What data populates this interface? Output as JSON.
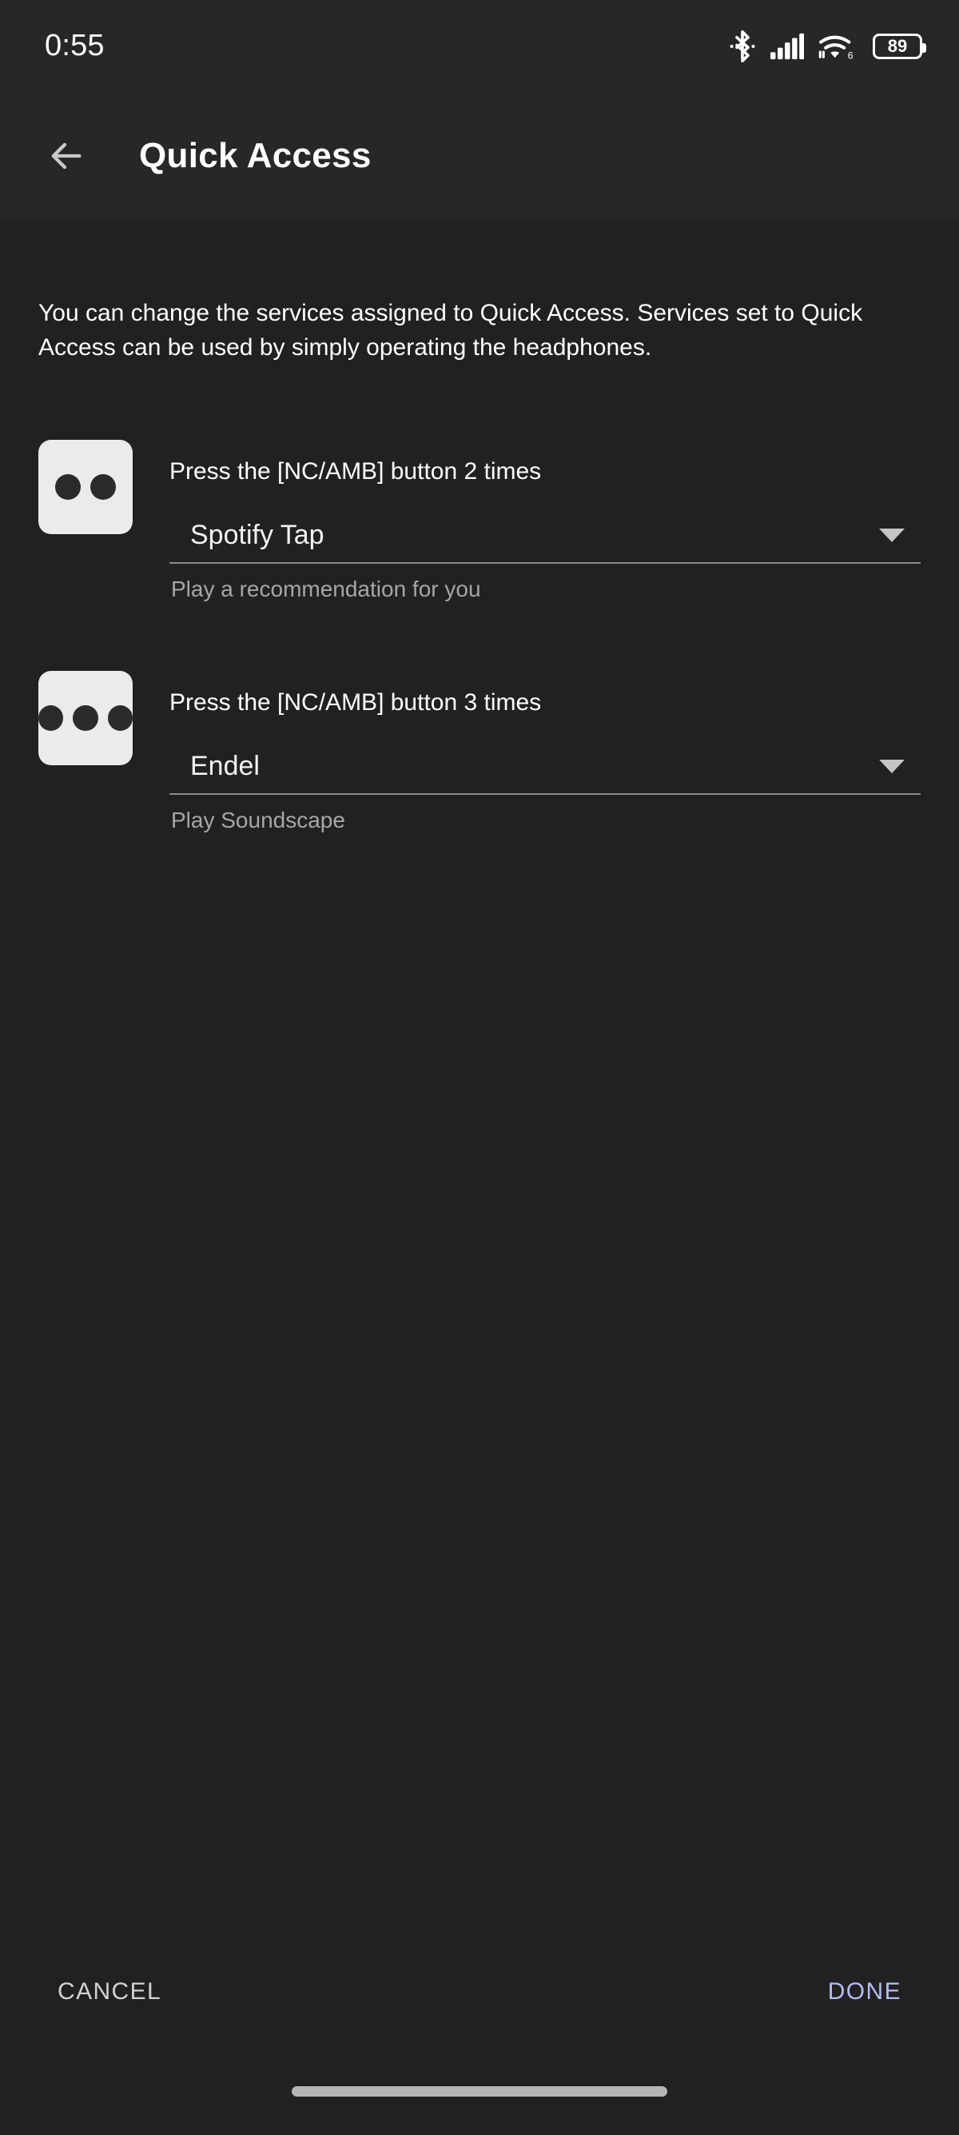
{
  "colors": {
    "background": "#212121",
    "app_bar": "#272727",
    "tile": "#ebebeb",
    "dot": "#2b2b2b",
    "divider": "#8a8a8a",
    "done_accent": "#b6bdf2",
    "cancel": "#d2d2d2",
    "caption": "#a6a6a6"
  },
  "status_bar": {
    "time": "0:55",
    "icons": [
      {
        "name": "bluetooth-icon"
      },
      {
        "name": "cellular-signal-icon"
      },
      {
        "name": "wifi-6-icon",
        "badge": "6"
      },
      {
        "name": "battery-icon"
      }
    ],
    "battery_level": "89"
  },
  "app_bar": {
    "back_icon": "back-arrow-icon",
    "title": "Quick Access"
  },
  "main": {
    "description": "You can change the services assigned to Quick Access. Services set to Quick Access can be used by simply operating the headphones.",
    "rows": [
      {
        "icon": "two-dots-icon",
        "dot_count": 2,
        "label": "Press the [NC/AMB] button 2 times",
        "selected_service": "Spotify Tap",
        "caption": "Play a recommendation for you",
        "caret_icon": "chevron-down-icon"
      },
      {
        "icon": "three-dots-icon",
        "dot_count": 3,
        "label": "Press the [NC/AMB] button 3 times",
        "selected_service": "Endel",
        "caption": "Play Soundscape",
        "caret_icon": "chevron-down-icon"
      }
    ]
  },
  "actions": {
    "cancel_label": "CANCEL",
    "done_label": "DONE"
  }
}
